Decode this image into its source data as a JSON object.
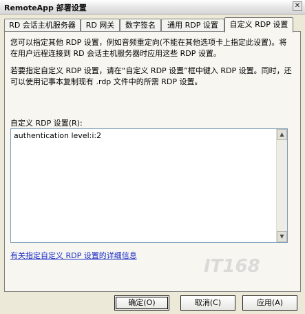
{
  "window": {
    "title": "RemoteApp 部署设置",
    "close_glyph": "✕"
  },
  "tabs": [
    {
      "label": "RD 会话主机服务器"
    },
    {
      "label": "RD 网关"
    },
    {
      "label": "数字签名"
    },
    {
      "label": "通用 RDP 设置"
    },
    {
      "label": "自定义 RDP 设置"
    }
  ],
  "active_tab": 4,
  "content": {
    "paragraph1": "您可以指定其他 RDP 设置，例如音频重定向(不能在其他选项卡上指定此设置)。将在用户远程连接到 RD 会话主机服务器时应用这些 RDP 设置。",
    "paragraph2": "若要指定自定义 RDP 设置，请在“自定义 RDP 设置”框中键入 RDP 设置。同时，还可以使用记事本复制现有 .rdp 文件中的所需 RDP 设置。",
    "field_label": "自定义 RDP 设置(R):",
    "field_value": "authentication level:i:2",
    "link": "有关指定自定义 RDP 设置的详细信息"
  },
  "buttons": {
    "ok": "确定(O)",
    "cancel": "取消(C)",
    "apply": "应用(A)"
  },
  "watermark": "IT168",
  "icons": {
    "scroll_up": "up-arrow-icon",
    "scroll_down": "down-arrow-icon"
  }
}
